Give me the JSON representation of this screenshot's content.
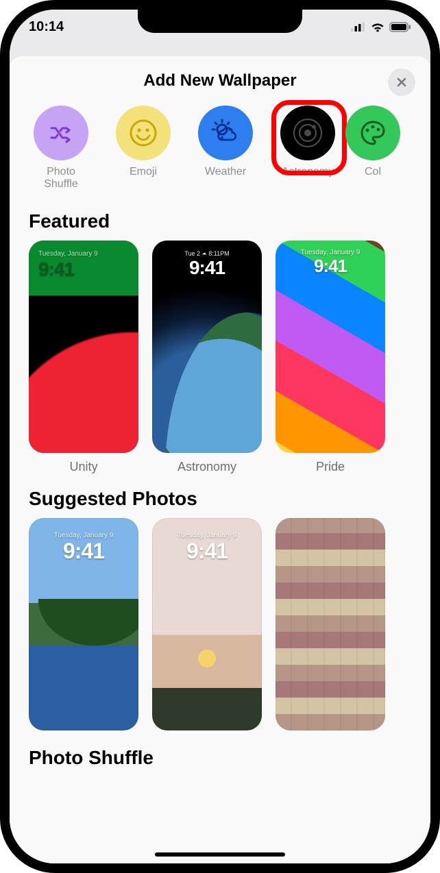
{
  "status": {
    "time": "10:14"
  },
  "sheet": {
    "title": "Add New Wallpaper"
  },
  "categories": [
    {
      "label": "Photo\nShuffle"
    },
    {
      "label": "Emoji"
    },
    {
      "label": "Weather"
    },
    {
      "label": "Astronomy"
    },
    {
      "label": "Col"
    }
  ],
  "highlighted_category_index": 3,
  "sections": {
    "featured": {
      "title": "Featured",
      "items": [
        {
          "label": "Unity",
          "day": "Tuesday, January 9",
          "time": "9:41"
        },
        {
          "label": "Astronomy",
          "day": "Tue 2 ⏶ 8:11PM",
          "time": "9:41"
        },
        {
          "label": "Pride",
          "day": "Tuesday, January 9",
          "time": "9:41"
        }
      ]
    },
    "suggested": {
      "title": "Suggested Photos",
      "items": [
        {
          "day": "Tuesday, January 9",
          "time": "9:41"
        },
        {
          "day": "Tuesday, January 9",
          "time": "9:41"
        },
        {
          "day": "",
          "time": ""
        }
      ]
    },
    "next_peek": {
      "title": "Photo Shuffle"
    }
  }
}
